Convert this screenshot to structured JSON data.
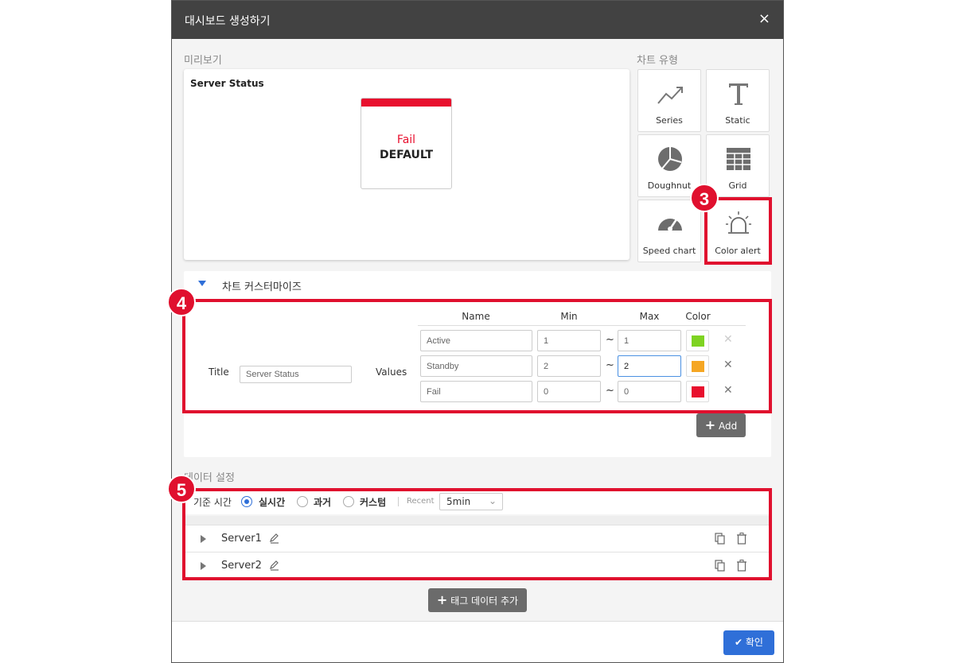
{
  "dialog": {
    "title": "대시보드 생성하기",
    "close_icon": "×"
  },
  "preview": {
    "section_label": "미리보기",
    "title": "Server Status",
    "alert_status": "Fail",
    "alert_value": "DEFAULT",
    "alert_color": "#e8102e"
  },
  "chart_types": {
    "section_label": "차트 유형",
    "items": [
      {
        "label": "Series",
        "icon": "trend-line-icon"
      },
      {
        "label": "Static",
        "icon": "text-t-icon"
      },
      {
        "label": "Doughnut",
        "icon": "pie-icon"
      },
      {
        "label": "Grid",
        "icon": "table-grid-icon"
      },
      {
        "label": "Speed chart",
        "icon": "gauge-icon"
      },
      {
        "label": "Color alert",
        "icon": "siren-icon"
      }
    ]
  },
  "badges": [
    "3",
    "4",
    "5"
  ],
  "customize": {
    "title": "차트 커스터마이즈",
    "title_label": "Title",
    "title_value": "Server Status",
    "values_label": "Values",
    "columns": [
      "Name",
      "Min",
      "Max",
      "Color"
    ],
    "rows": [
      {
        "name": "Active",
        "min": "1",
        "max": "1",
        "color": "#7ed321"
      },
      {
        "name": "Standby",
        "min": "2",
        "max": "2",
        "color": "#f5a623"
      },
      {
        "name": "Fail",
        "min": "0",
        "max": "0",
        "color": "#e8102e"
      }
    ],
    "tilde": "~",
    "add_label": "Add"
  },
  "data_settings": {
    "section_label": "데이터 설정",
    "time_label": "기준 시간",
    "radio_options": [
      "실시간",
      "과거",
      "커스텀"
    ],
    "recent_label": "Recent",
    "recent_value": "5min",
    "servers": [
      "Server1",
      "Server2"
    ],
    "add_tag_label": "태그 데이터 추가"
  },
  "footer": {
    "confirm_label": "확인"
  }
}
